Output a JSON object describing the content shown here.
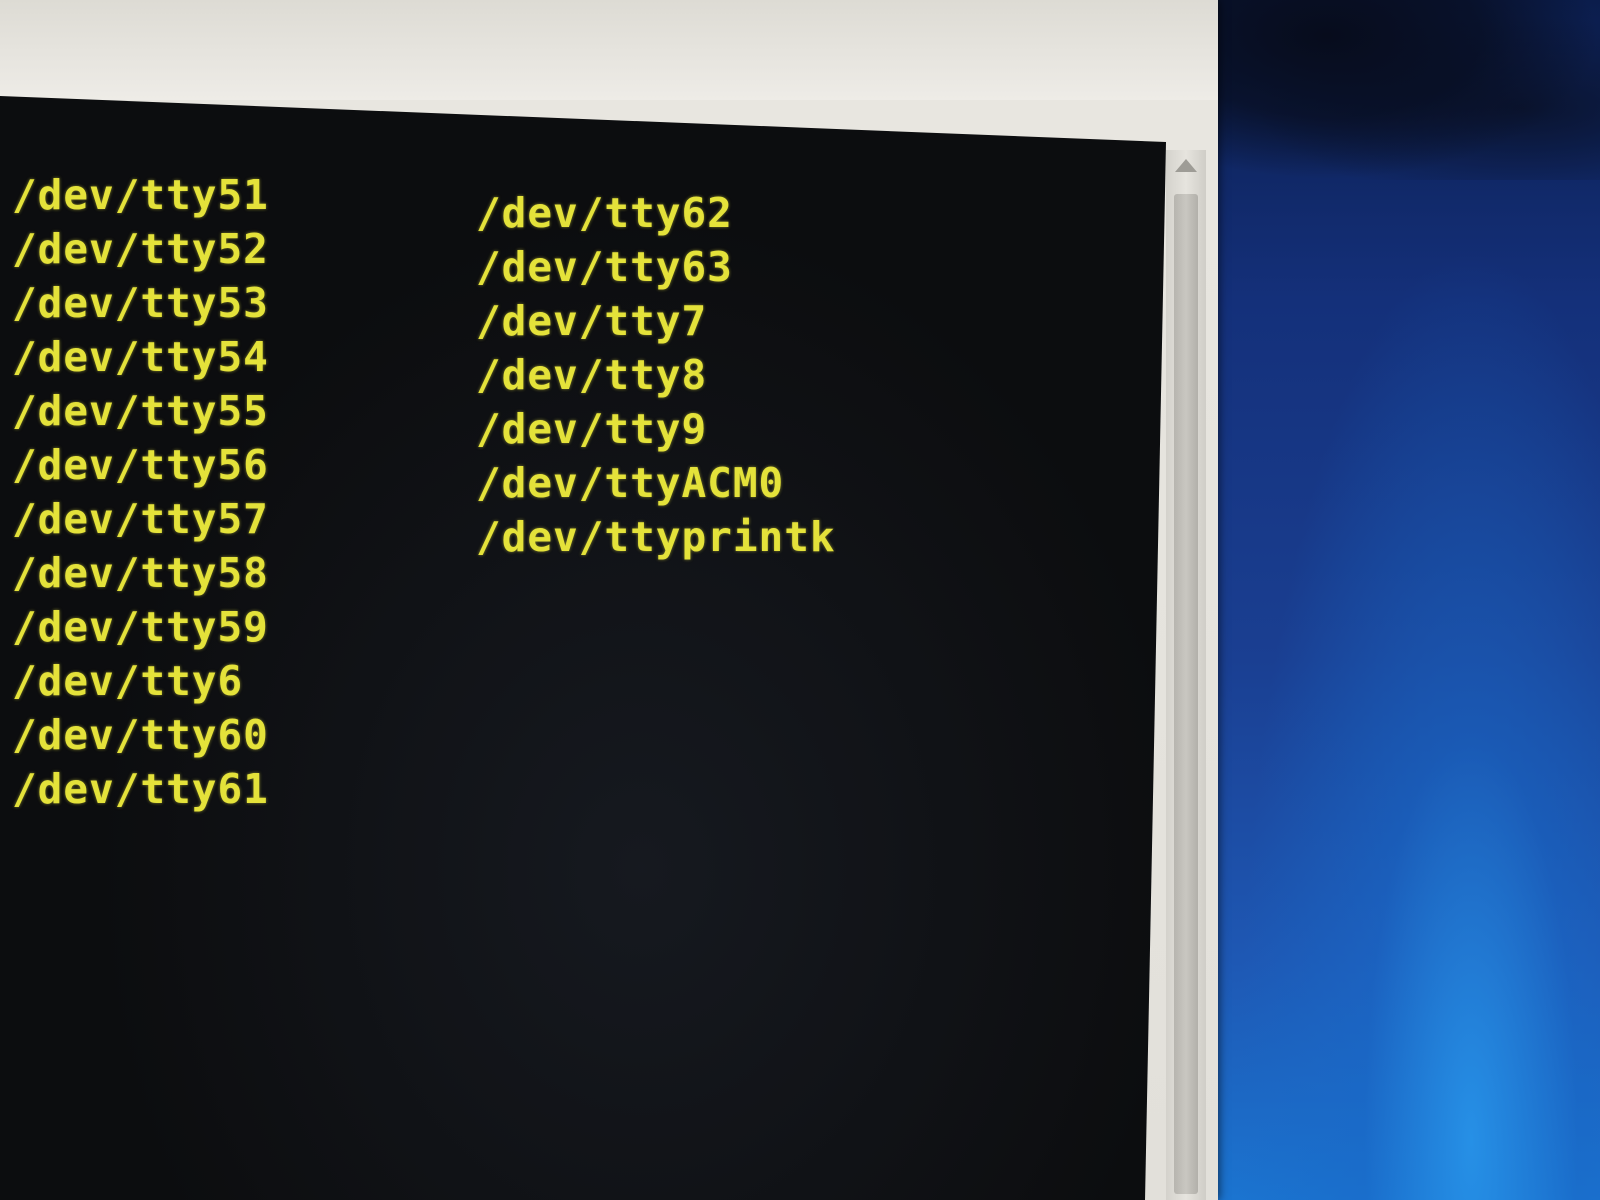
{
  "terminal": {
    "column_one": [
      "/dev/tty51",
      "/dev/tty52",
      "/dev/tty53",
      "/dev/tty54",
      "/dev/tty55",
      "/dev/tty56",
      "/dev/tty57",
      "/dev/tty58",
      "/dev/tty59",
      "/dev/tty6",
      "/dev/tty60",
      "/dev/tty61"
    ],
    "column_two": [
      "/dev/tty62",
      "/dev/tty63",
      "/dev/tty7",
      "/dev/tty8",
      "/dev/tty9",
      "/dev/ttyACM0",
      "/dev/ttyprintk"
    ],
    "text_color": "#e4e23a",
    "background_color": "#0c0d0f"
  },
  "scrollbar": {
    "up_icon": "chevron-up-icon"
  }
}
